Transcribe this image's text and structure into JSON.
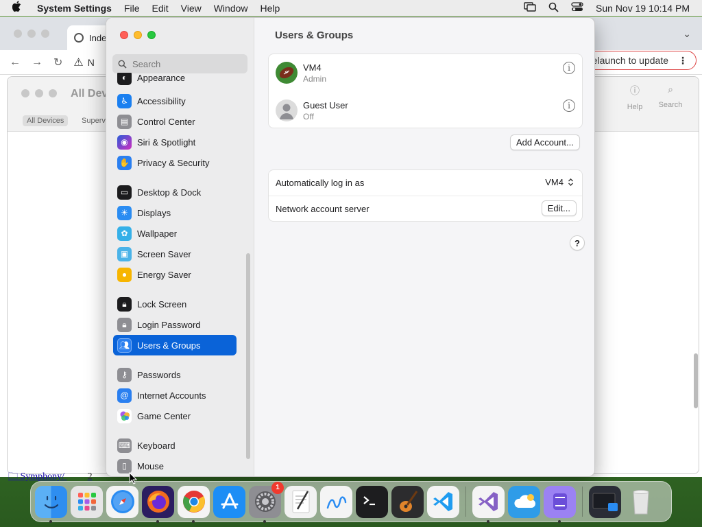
{
  "menubar": {
    "app": "System Settings",
    "items": [
      "File",
      "Edit",
      "View",
      "Window",
      "Help"
    ],
    "clock": "Sun Nov 19  10:14 PM"
  },
  "browser": {
    "tab_title": "Inde",
    "nav_text": "N",
    "relaunch": "Relaunch to update",
    "inner_title": "All Dev",
    "chip": "All Devices",
    "chip2": "Superv",
    "help_btn": "Help",
    "search_btn": "Search",
    "link": "Symphony/",
    "link_extra": "2"
  },
  "settings": {
    "search_placeholder": "Search",
    "sidebar": [
      {
        "label": "Appearance",
        "icon": "appearance-icon",
        "color": "#1c1c1e"
      },
      {
        "label": "Accessibility",
        "icon": "accessibility-icon",
        "color": "#1a7ff0"
      },
      {
        "label": "Control Center",
        "icon": "control-center-icon",
        "color": "#8e8e93"
      },
      {
        "label": "Siri & Spotlight",
        "icon": "siri-icon",
        "color": "#b03be0"
      },
      {
        "label": "Privacy & Security",
        "icon": "hand-icon",
        "color": "#2a7ff0"
      },
      {
        "label": "Desktop & Dock",
        "icon": "dock-icon",
        "color": "#1c1c1e"
      },
      {
        "label": "Displays",
        "icon": "displays-icon",
        "color": "#2a8cf2"
      },
      {
        "label": "Wallpaper",
        "icon": "wallpaper-icon",
        "color": "#35b0e8"
      },
      {
        "label": "Screen Saver",
        "icon": "screen-saver-icon",
        "color": "#4ab3e8"
      },
      {
        "label": "Energy Saver",
        "icon": "energy-saver-icon",
        "color": "#f7b500"
      },
      {
        "label": "Lock Screen",
        "icon": "lock-icon",
        "color": "#1c1c1e"
      },
      {
        "label": "Login Password",
        "icon": "login-lock-icon",
        "color": "#8e8e93"
      },
      {
        "label": "Users & Groups",
        "icon": "users-icon",
        "color": "#2a7ff0"
      },
      {
        "label": "Passwords",
        "icon": "key-icon",
        "color": "#8e8e93"
      },
      {
        "label": "Internet Accounts",
        "icon": "at-icon",
        "color": "#2a7ff0"
      },
      {
        "label": "Game Center",
        "icon": "game-center-icon",
        "color": "#ffffff"
      },
      {
        "label": "Keyboard",
        "icon": "keyboard-icon",
        "color": "#8e8e93"
      },
      {
        "label": "Mouse",
        "icon": "mouse-icon",
        "color": "#8e8e93"
      }
    ],
    "title": "Users & Groups",
    "users": [
      {
        "name": "VM4",
        "role": "Admin"
      },
      {
        "name": "Guest User",
        "role": "Off"
      }
    ],
    "add_account": "Add Account...",
    "auto_login_label": "Automatically log in as",
    "auto_login_value": "VM4",
    "network_label": "Network account server",
    "edit_btn": "Edit...",
    "help": "?"
  },
  "dock": {
    "apps": [
      {
        "name": "finder-icon",
        "color": "#2e8ef0"
      },
      {
        "name": "launchpad-icon",
        "color": "#e6e6e6"
      },
      {
        "name": "safari-icon",
        "color": "#f4f4f4"
      },
      {
        "name": "firefox-icon",
        "color": "#2b1d60"
      },
      {
        "name": "chrome-icon",
        "color": "#f4f4f4"
      },
      {
        "name": "app-store-icon",
        "color": "#1d8ef5"
      },
      {
        "name": "system-settings-icon",
        "color": "#8e8e93"
      },
      {
        "name": "textedit-icon",
        "color": "#f2f2f2"
      },
      {
        "name": "freeform-icon",
        "color": "#f4f4f4"
      },
      {
        "name": "terminal-icon",
        "color": "#1d1d1f"
      },
      {
        "name": "garageband-icon",
        "color": "#2c2c2e"
      },
      {
        "name": "vscode-icon",
        "color": "#f4f4f4"
      },
      {
        "name": "visual-studio-icon",
        "color": "#f4f4f4"
      },
      {
        "name": "icloud-icon",
        "color": "#2f9ce8"
      },
      {
        "name": "podman-icon",
        "color": "#9b82f3"
      },
      {
        "name": "screenshot-icon",
        "color": "#2a2d36"
      },
      {
        "name": "trash-icon",
        "color": "#e4e4e4"
      }
    ],
    "badge": "1"
  }
}
